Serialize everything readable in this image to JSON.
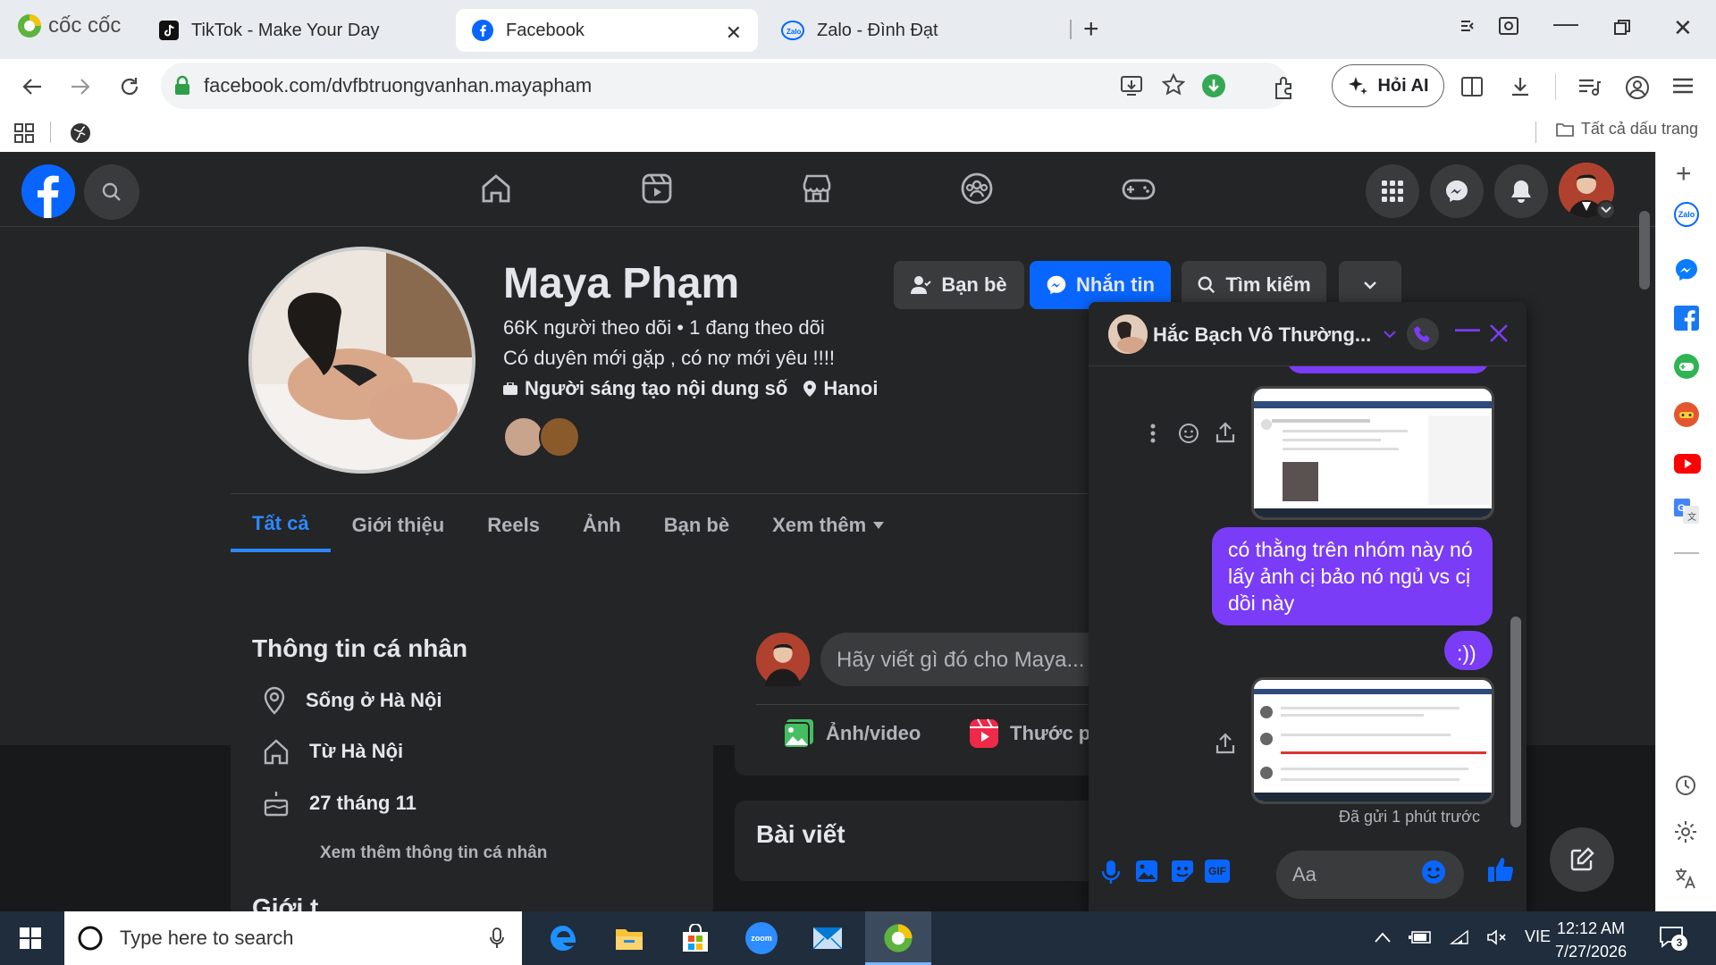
{
  "browser": {
    "brand": "cốc cốc",
    "tabs": [
      {
        "title": "TikTok - Make Your Day",
        "active": false
      },
      {
        "title": "Facebook",
        "active": true
      },
      {
        "title": "Zalo - Đình Đạt",
        "active": false
      }
    ],
    "url": "facebook.com/dvfbtruongvanhan.mayapham",
    "ask_ai": "Hỏi AI",
    "all_bookmarks": "Tất cả dấu trang"
  },
  "profile": {
    "name": "Maya Phạm",
    "follow_stats": "66K người theo dõi • 1 đang theo dõi",
    "bio": "Có duyên mới gặp , có nợ mới yêu !!!!",
    "category": "Người sáng tạo nội dung số",
    "location": "Hanoi",
    "buttons": {
      "friends": "Bạn bè",
      "message": "Nhắn tin",
      "search": "Tìm kiếm"
    },
    "tabs": [
      "Tất cả",
      "Giới thiệu",
      "Reels",
      "Ảnh",
      "Bạn bè",
      "Xem thêm"
    ]
  },
  "intro": {
    "title": "Thông tin cá nhân",
    "lives_in": "Sống ở Hà Nội",
    "from": "Từ Hà Nội",
    "birthday": "27 tháng 11",
    "see_more": "Xem thêm thông tin cá nhân",
    "next_section_cut": "Giới t"
  },
  "composer": {
    "placeholder": "Hãy viết gì đó cho Maya...",
    "photo_video": "Ảnh/video",
    "reel": "Thước phim"
  },
  "posts": {
    "title": "Bài viết"
  },
  "chat": {
    "contact_name": "Hắc Bạch Vô Thường...",
    "messages": [
      "có thằng trên nhóm này nó lấy ảnh cị bảo nó ngủ vs cị dồi này",
      ":))"
    ],
    "sent_status": "Đã gửi 1 phút trước",
    "input_placeholder": "Aa"
  },
  "taskbar": {
    "search_placeholder": "Type here to search",
    "language": "VIE",
    "time": "12:12 AM",
    "date": "7/27/2026",
    "notification_count": "3"
  },
  "colors": {
    "fb_blue": "#0866ff",
    "messenger_purple": "#7a3cf7",
    "fb_dark_bg": "#18191a",
    "fb_card": "#242526"
  }
}
